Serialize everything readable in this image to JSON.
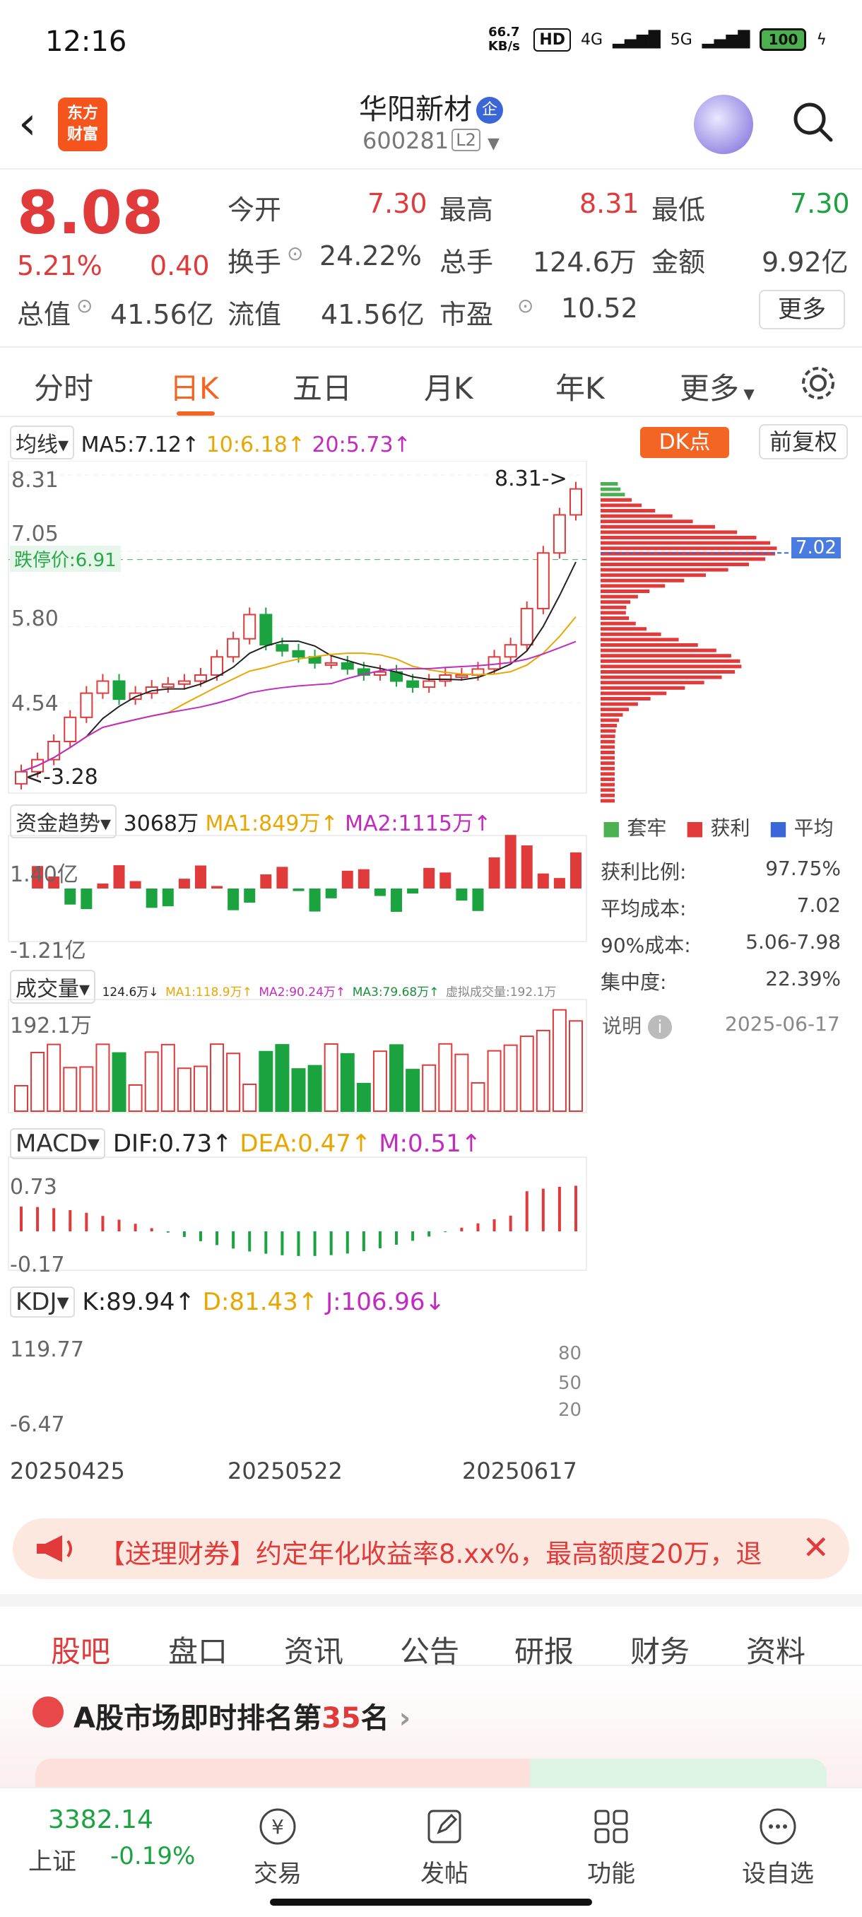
{
  "status": {
    "time": "12:16",
    "net_speed": "66.7 KB/s",
    "hd": "HD",
    "sig4g": "4G",
    "sig5g": "5G",
    "battery": "100"
  },
  "header": {
    "logo": "东方\n财富",
    "name": "华阳新材",
    "tag": "企",
    "code": "600281",
    "level": "L2"
  },
  "quote": {
    "price": "8.08",
    "change_pct": "5.21%",
    "change_val": "0.40",
    "open_label": "今开",
    "open": "7.30",
    "high_label": "最高",
    "high": "8.31",
    "low_label": "最低",
    "low": "7.30",
    "turnover_label": "换手",
    "turnover": "24.22%",
    "vol_label": "总手",
    "vol": "124.6万",
    "amount_label": "金额",
    "amount": "9.92亿",
    "mcap_label": "总值",
    "mcap": "41.56亿",
    "float_label": "流值",
    "float": "41.56亿",
    "pe_label": "市盈",
    "pe": "10.52",
    "more": "更多"
  },
  "ktabs": [
    "分时",
    "日K",
    "五日",
    "月K",
    "年K",
    "更多"
  ],
  "chart": {
    "ma_pill": "均线",
    "ma5": "MA5:7.12↑",
    "ma10": "10:6.18↑",
    "ma20": "20:5.73↑",
    "dk": "DK点",
    "fq": "前复权",
    "y_labels": [
      "8.31",
      "7.05",
      "5.80",
      "4.54",
      "3.28"
    ],
    "max_label": "8.31->",
    "min_label": "<-3.28",
    "limit_label": "跌停价:6.91",
    "chip_price": "7.02",
    "fund_pill": "资金趋势",
    "fund_val": "3068万",
    "fund_ma1": "MA1:849万↑",
    "fund_ma2": "MA2:1115万↑",
    "fund_hi": "1.40亿",
    "fund_lo": "-1.21亿",
    "vol_pill": "成交量",
    "vol_line": "124.6万↓",
    "vol_ma1": "MA1:118.9万↑",
    "vol_ma2": "MA2:90.24万↑",
    "vol_ma3": "MA3:79.68万↑",
    "vol_virt": "虚拟成交量:192.1万",
    "vol_hi": "192.1万",
    "macd_pill": "MACD",
    "dif": "DIF:0.73↑",
    "dea": "DEA:0.47↑",
    "m": "M:0.51↑",
    "macd_hi": "0.73",
    "macd_lo": "-0.17",
    "kdj_pill": "KDJ",
    "k": "K:89.94↑",
    "d": "D:81.43↑",
    "j": "J:106.96↓",
    "kdj_hi": "119.77",
    "kdj_lo": "-6.47",
    "kdj_levels": [
      "80",
      "50",
      "20"
    ],
    "dates": [
      "20250425",
      "20250522",
      "20250617"
    ],
    "legend": [
      "套牢",
      "获利",
      "平均"
    ],
    "chip_stats": [
      [
        "获利比例:",
        "97.75%"
      ],
      [
        "平均成本:",
        "7.02"
      ],
      [
        "90%成本:",
        "5.06-7.98"
      ],
      [
        "集中度:",
        "22.39%"
      ]
    ],
    "explain": "说明",
    "chip_date": "2025-06-17"
  },
  "chart_data": {
    "type": "line",
    "title": "",
    "candles_close": [
      3.4,
      3.6,
      3.9,
      4.3,
      4.7,
      4.9,
      4.6,
      4.7,
      4.8,
      4.85,
      4.9,
      5.0,
      5.3,
      5.6,
      6.0,
      5.5,
      5.4,
      5.3,
      5.2,
      5.2,
      5.1,
      5.0,
      5.05,
      4.9,
      4.8,
      4.9,
      5.0,
      5.0,
      5.1,
      5.3,
      5.5,
      6.1,
      7.02,
      7.65,
      8.08
    ],
    "ylim": [
      3.28,
      8.31
    ],
    "xlabels": [
      "20250425",
      "20250522",
      "20250617"
    ]
  },
  "ad": {
    "text": "【送理财券】约定年化收益率8.xx%，最高额度20万，退"
  },
  "tabs2": [
    "股吧",
    "盘口",
    "资讯",
    "公告",
    "研报",
    "财务",
    "资料"
  ],
  "rank": {
    "prefix": "A股市场即时排名第",
    "num": "35",
    "suffix": "名"
  },
  "bottom": {
    "index_val": "3382.14",
    "index_name": "上证",
    "index_chg": "-0.19%",
    "items": [
      "交易",
      "发帖",
      "功能",
      "设自选"
    ]
  }
}
